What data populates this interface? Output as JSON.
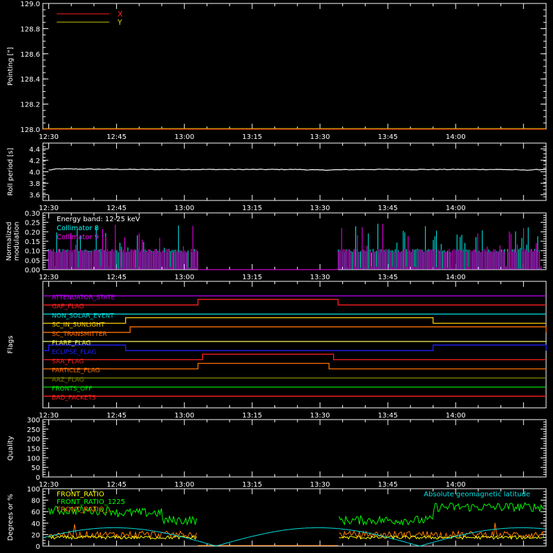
{
  "chart_data": [
    {
      "type": "line",
      "ylabel": "Pointing [\"]",
      "ylim": [
        128.0,
        129.0
      ],
      "yticks": [
        "128.0",
        "128.2",
        "128.4",
        "128.6",
        "128.8",
        "129.0"
      ],
      "xticks": [
        "12:30",
        "12:45",
        "13:00",
        "13:15",
        "13:30",
        "13:45",
        "14:00"
      ],
      "xlim_minutes": [
        0,
        110
      ],
      "legend_position": "top-left",
      "series": [
        {
          "name": "X",
          "color": "#ff2020"
        },
        {
          "name": "Y",
          "color": "#c8c800"
        }
      ]
    },
    {
      "type": "line",
      "ylabel": "Roll period [s]",
      "ylim": [
        3.5,
        4.5
      ],
      "yticks": [
        "3.6",
        "3.8",
        "4.0",
        "4.2",
        "4.4"
      ],
      "xticks": [
        "12:30",
        "12:45",
        "13:00",
        "13:15",
        "13:30",
        "13:45",
        "14:00"
      ],
      "series": [
        {
          "color": "#ffffff",
          "x": [
            0,
            2,
            20,
            40,
            55,
            60,
            70,
            80,
            90,
            100,
            105,
            110
          ],
          "values": [
            4.03,
            4.05,
            4.04,
            4.04,
            4.04,
            4.03,
            4.04,
            4.04,
            4.04,
            4.04,
            4.03,
            4.04
          ]
        }
      ]
    },
    {
      "type": "line",
      "ylabel": "Normalized modulation",
      "ylim": [
        0.0,
        0.3
      ],
      "yticks": [
        "0.00",
        "0.05",
        "0.10",
        "0.15",
        "0.20",
        "0.25",
        "0.30"
      ],
      "xticks": [
        "12:30",
        "12:45",
        "13:00",
        "13:15",
        "13:30",
        "13:45",
        "14:00"
      ],
      "annotation": "Energy band: 12-25 keV",
      "series": [
        {
          "name": "Collimator 8",
          "color": "#00ffff",
          "gaps": [
            [
              33,
              64
            ]
          ]
        },
        {
          "name": "Collimator 9",
          "color": "#ff00ff",
          "gaps": [
            [
              33,
              64
            ]
          ]
        }
      ]
    },
    {
      "type": "step",
      "ylabel": "Flags",
      "xticks": [
        "12:30",
        "12:45",
        "13:00",
        "13:15",
        "13:30",
        "13:45",
        "14:00"
      ],
      "flags": [
        {
          "name": "ATTENUATOR_STATE",
          "color": "#c000ff",
          "intervals": []
        },
        {
          "name": "GAP_FLAG",
          "color": "#ff2020",
          "intervals": [
            [
              33,
              64
            ]
          ]
        },
        {
          "name": "NON_SOLAR_EVENT",
          "color": "#00e0e0",
          "intervals": []
        },
        {
          "name": "SC_IN_SUNLIGHT",
          "color": "#ffd000",
          "intervals": [
            [
              17,
              85
            ]
          ]
        },
        {
          "name": "SC_TRANSMITTER",
          "color": "#ff7000",
          "intervals": [
            [
              18,
              110
            ]
          ]
        },
        {
          "name": "FLARE_FLAG",
          "color": "#ffff60",
          "intervals": []
        },
        {
          "name": "ECLIPSE_FLAG",
          "color": "#2020ff",
          "intervals": [
            [
              0,
              17
            ],
            [
              85,
              110
            ]
          ]
        },
        {
          "name": "SAA_FLAG",
          "color": "#ff2020",
          "intervals": [
            [
              34,
              63
            ]
          ]
        },
        {
          "name": "PARTICLE_FLAG",
          "color": "#ff7000",
          "intervals": [
            [
              33,
              62
            ]
          ]
        },
        {
          "name": "AAZ_FLAG",
          "color": "#808000",
          "intervals": []
        },
        {
          "name": "FRONTS_OFF",
          "color": "#00e000",
          "intervals": []
        },
        {
          "name": "BAD_PACKETS",
          "color": "#ff2020",
          "intervals": []
        }
      ]
    },
    {
      "type": "line",
      "ylabel": "Quality",
      "ylim": [
        0,
        300
      ],
      "yticks": [
        "0",
        "50",
        "100",
        "150",
        "200",
        "250",
        "300"
      ],
      "xticks": [
        "12:30",
        "12:45",
        "13:00",
        "13:15",
        "13:30",
        "13:45",
        "14:00"
      ]
    },
    {
      "type": "line",
      "ylabel": "Degrees or %",
      "ylim": [
        0,
        100
      ],
      "yticks": [
        "0",
        "20",
        "40",
        "60",
        "80",
        "100"
      ],
      "annotation": "Absolute geomagnetic latitude",
      "series": [
        {
          "name": "FRONT_RATIO",
          "color": "#ffff00"
        },
        {
          "name": "FRONT_RATIO_1225",
          "color": "#00ff00"
        },
        {
          "name": "FRONT_RATIO_...",
          "color": "#ff8000"
        },
        {
          "name": "Absolute geomagnetic latitude",
          "color": "#00e0e0"
        }
      ]
    }
  ]
}
